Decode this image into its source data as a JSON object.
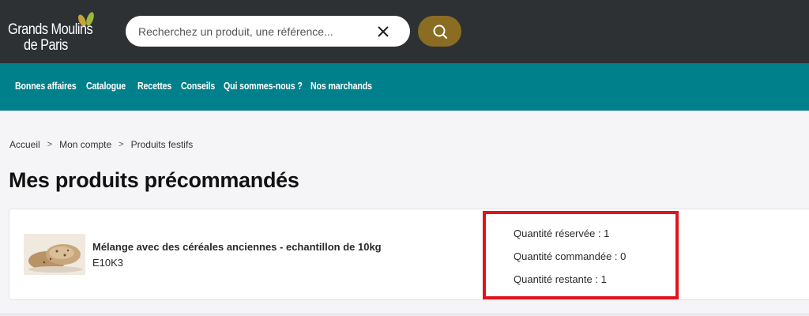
{
  "header": {
    "logo_line1": "Grands Moulins",
    "logo_line2": "de Paris",
    "search": {
      "placeholder": "Recherchez un produit, une référence...",
      "value": ""
    },
    "clear_icon": "close-icon",
    "search_icon": "search-icon",
    "accent_color": "#8a6d22",
    "bar_color": "#2d3133"
  },
  "nav": {
    "color": "#00808a",
    "items": [
      {
        "label": "Bonnes affaires"
      },
      {
        "label": "Catalogue"
      },
      {
        "label": "Recettes"
      },
      {
        "label": "Conseils"
      },
      {
        "label": "Qui sommes-nous ?"
      },
      {
        "label": "Nos marchands"
      }
    ]
  },
  "breadcrumb": {
    "items": [
      {
        "label": "Accueil"
      },
      {
        "label": "Mon compte"
      },
      {
        "label": "Produits festifs"
      }
    ],
    "separator": ">"
  },
  "page": {
    "title": "Mes produits précommandés"
  },
  "product": {
    "name": "Mélange avec des céréales anciennes - echantillon de 10kg",
    "reference": "E10K3",
    "quantities": [
      {
        "label": "Quantité réservée : 1"
      },
      {
        "label": "Quantité commandée : 0"
      },
      {
        "label": "Quantité restante : 1"
      }
    ]
  },
  "highlight_color": "#e0141c"
}
